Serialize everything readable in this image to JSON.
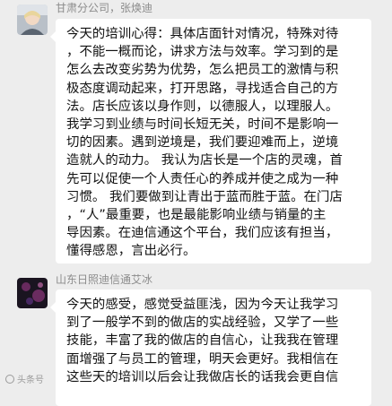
{
  "messages": [
    {
      "sender": "甘肃分公司，张焕迪",
      "avatar": "avatar-light-photo",
      "lines": [
        "今天的培训心得：具体店面针对情况，特殊对待",
        "，不能一概而论，讲求方法与效率。学习到的是",
        "怎么去改变劣势为优势，怎么把员工的激情与积",
        "极态度调动起来，打开思路，寻找适合自己的方",
        "法。店长应该以身作则，以德服人，以理服人。",
        "我学习到业绩与时间长短无关，时间不是影响一",
        "切的因素。遇到逆境是，我们要迎难而上，逆境",
        "造就人的动力。 我认为店长是一个店的灵魂，首",
        "先可以促使一个人责任心的养成并使之成为一种",
        "习惯。 我们要做到让青出于蓝而胜于蓝。在门店",
        "，“人”最重要，也是最能影响业绩与销量的主",
        "导因素。在迪信通这个平台，我们应该有担当，",
        "懂得感恩，言出必行。"
      ]
    },
    {
      "sender": "山东日照迪信通艾冰",
      "avatar": "avatar-dark-photo",
      "lines": [
        "今天的感受，感觉受益匪浅，因为今天让我学习",
        "到了一般学不到的做店的实战经验，又学了一些",
        "技能，丰富了我的做店的自信心，让我我在管理",
        "面增强了与员工的管理，明天会更好。我相信在",
        "这些天的培训以后会让我做店长的话我会更自信"
      ]
    }
  ],
  "watermark": "头条号",
  "colors": {
    "background": "#ededed",
    "bubble": "#ffffff",
    "sender_text": "#8c8c8c"
  }
}
